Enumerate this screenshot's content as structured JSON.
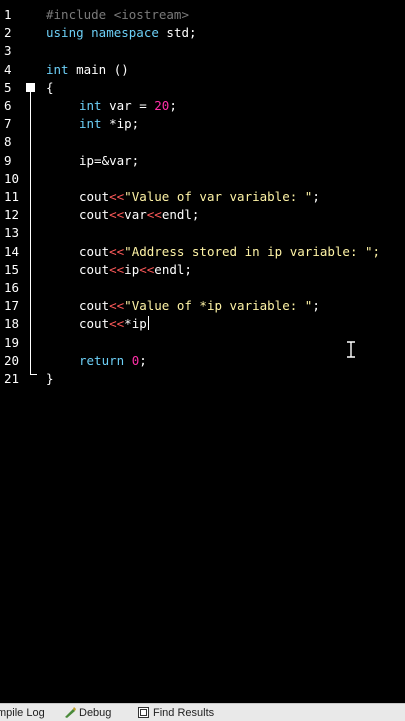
{
  "editor": {
    "lines": [
      {
        "n": "1",
        "tokens": [
          {
            "t": "#include <iostream>",
            "c": "pre"
          }
        ]
      },
      {
        "n": "2",
        "tokens": [
          {
            "t": "using namespace",
            "c": "kw"
          },
          {
            "t": " std;",
            "c": "id"
          }
        ]
      },
      {
        "n": "3",
        "tokens": []
      },
      {
        "n": "4",
        "tokens": [
          {
            "t": "int",
            "c": "kw"
          },
          {
            "t": " main ()",
            "c": "id"
          }
        ]
      },
      {
        "n": "5",
        "tokens": [
          {
            "t": "{",
            "c": "brace"
          }
        ]
      },
      {
        "n": "6",
        "indent": true,
        "tokens": [
          {
            "t": "int",
            "c": "kw"
          },
          {
            "t": " var = ",
            "c": "id"
          },
          {
            "t": "20",
            "c": "num"
          },
          {
            "t": ";",
            "c": "id"
          }
        ]
      },
      {
        "n": "7",
        "indent": true,
        "tokens": [
          {
            "t": "int",
            "c": "kw"
          },
          {
            "t": " *ip;",
            "c": "id"
          }
        ]
      },
      {
        "n": "8",
        "tokens": []
      },
      {
        "n": "9",
        "indent": true,
        "tokens": [
          {
            "t": "ip=&var;",
            "c": "id"
          }
        ]
      },
      {
        "n": "10",
        "tokens": []
      },
      {
        "n": "11",
        "indent": true,
        "tokens": [
          {
            "t": "cout",
            "c": "id"
          },
          {
            "t": "<<",
            "c": "op"
          },
          {
            "t": "\"Value of var variable: \"",
            "c": "str"
          },
          {
            "t": ";",
            "c": "id"
          }
        ]
      },
      {
        "n": "12",
        "indent": true,
        "tokens": [
          {
            "t": "cout",
            "c": "id"
          },
          {
            "t": "<<",
            "c": "op"
          },
          {
            "t": "var",
            "c": "id"
          },
          {
            "t": "<<",
            "c": "op"
          },
          {
            "t": "endl;",
            "c": "id"
          }
        ]
      },
      {
        "n": "13",
        "tokens": []
      },
      {
        "n": "14",
        "indent": true,
        "tokens": [
          {
            "t": "cout",
            "c": "id"
          },
          {
            "t": "<<",
            "c": "op"
          },
          {
            "t": "\"Address stored in ip variable: \";",
            "c": "str"
          }
        ]
      },
      {
        "n": "15",
        "indent": true,
        "tokens": [
          {
            "t": "cout",
            "c": "id"
          },
          {
            "t": "<<",
            "c": "op"
          },
          {
            "t": "ip",
            "c": "id"
          },
          {
            "t": "<<",
            "c": "op"
          },
          {
            "t": "endl;",
            "c": "id"
          }
        ]
      },
      {
        "n": "16",
        "tokens": []
      },
      {
        "n": "17",
        "indent": true,
        "tokens": [
          {
            "t": "cout",
            "c": "id"
          },
          {
            "t": "<<",
            "c": "op"
          },
          {
            "t": "\"Value of *ip variable: \"",
            "c": "str"
          },
          {
            "t": ";",
            "c": "id"
          }
        ]
      },
      {
        "n": "18",
        "indent": true,
        "caret": true,
        "tokens": [
          {
            "t": "cout",
            "c": "id"
          },
          {
            "t": "<<",
            "c": "op"
          },
          {
            "t": "*ip",
            "c": "id"
          }
        ]
      },
      {
        "n": "19",
        "tokens": []
      },
      {
        "n": "20",
        "indent": true,
        "tokens": [
          {
            "t": "return",
            "c": "kw"
          },
          {
            "t": " ",
            "c": "id"
          },
          {
            "t": "0",
            "c": "num"
          },
          {
            "t": ";",
            "c": "id"
          }
        ]
      },
      {
        "n": "21",
        "tokens": [
          {
            "t": "}",
            "c": "brace"
          }
        ]
      }
    ]
  },
  "bottom_tabs": [
    {
      "label": "mpile Log",
      "icon": "compile-log-icon"
    },
    {
      "label": "Debug",
      "icon": "debug-icon"
    },
    {
      "label": "Find Results",
      "icon": "find-results-icon"
    }
  ]
}
